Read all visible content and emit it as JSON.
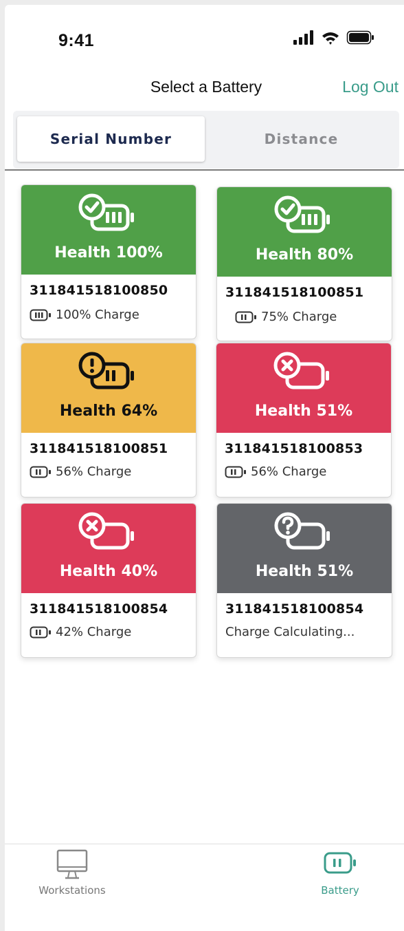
{
  "status_bar": {
    "time": "9:41"
  },
  "header": {
    "title": "Select a Battery",
    "logout_label": "Log Out"
  },
  "segment": {
    "serial_label": "Serial Number",
    "distance_label": "Distance",
    "selected": "serial"
  },
  "cards": [
    {
      "status": "ok",
      "health": "Health 100%",
      "serial": "311841518100850",
      "charge": "100% Charge",
      "color": "#50a048",
      "icon": "battery-check-icon"
    },
    {
      "status": "ok",
      "health": "Health 80%",
      "serial": "311841518100851",
      "charge": "75% Charge",
      "color": "#50a048",
      "icon": "battery-check-icon"
    },
    {
      "status": "warning",
      "health": "Health 64%",
      "serial": "311841518100851",
      "charge": "56% Charge",
      "color": "#efb84a",
      "icon": "battery-warning-icon"
    },
    {
      "status": "error",
      "health": "Health 51%",
      "serial": "311841518100853",
      "charge": "56% Charge",
      "color": "#dd3b59",
      "icon": "battery-error-icon"
    },
    {
      "status": "error",
      "health": "Health 40%",
      "serial": "311841518100854",
      "charge": "42% Charge",
      "color": "#dd3b59",
      "icon": "battery-error-icon"
    },
    {
      "status": "unknown",
      "health": "Health 51%",
      "serial": "311841518100854",
      "charge": "Charge Calculating...",
      "color": "#636569",
      "icon": "battery-unknown-icon"
    }
  ],
  "tabbar": {
    "workstations_label": "Workstations",
    "battery_label": "Battery",
    "active": "battery"
  },
  "colors": {
    "accent": "#3a9c8a",
    "good": "#50a048",
    "warning": "#efb84a",
    "bad": "#dd3b59",
    "unknown": "#636569"
  }
}
